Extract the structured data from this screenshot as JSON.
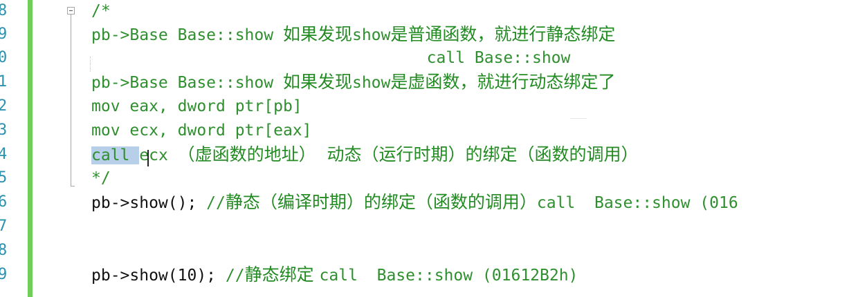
{
  "line_numbers": [
    "8",
    "9",
    "0",
    "1",
    "2",
    "3",
    "4",
    "5",
    "6",
    "7",
    "8",
    "9"
  ],
  "code_lines": [
    {
      "segments": [
        {
          "cls": "cm",
          "text": "/*"
        }
      ]
    },
    {
      "segments": [
        {
          "cls": "cm",
          "text": "pb->Base Base::show "
        },
        {
          "cls": "cn",
          "text": "如果发现"
        },
        {
          "cls": "cm",
          "text": "show"
        },
        {
          "cls": "cn",
          "text": "是普通函数，就进行静态绑定"
        }
      ]
    },
    {
      "segments": [
        {
          "cls": "cm",
          "text": "                                   call Base::show"
        }
      ]
    },
    {
      "segments": [
        {
          "cls": "cm",
          "text": "pb->Base Base::show "
        },
        {
          "cls": "cn",
          "text": "如果发现"
        },
        {
          "cls": "cm",
          "text": "show"
        },
        {
          "cls": "cn",
          "text": "是虚函数，就进行动态绑定了"
        }
      ]
    },
    {
      "segments": [
        {
          "cls": "cm",
          "text": "mov eax, dword ptr[pb]"
        }
      ]
    },
    {
      "segments": [
        {
          "cls": "cm",
          "text": "mov ecx, dword ptr[eax]"
        }
      ]
    },
    {
      "segments": [
        {
          "cls": "sel",
          "text": "call "
        },
        {
          "cls": "cm",
          "text": "ecx "
        },
        {
          "cls": "cn",
          "text": "（虚函数的地址）  动态（运行时期）的绑定（函数的调用）"
        }
      ]
    },
    {
      "segments": [
        {
          "cls": "cm",
          "text": "*/"
        }
      ]
    },
    {
      "segments": [
        {
          "cls": "code",
          "text": "pb->show(); "
        },
        {
          "cls": "cm",
          "text": "//"
        },
        {
          "cls": "cn",
          "text": "静态（编译时期）的绑定（函数的调用）"
        },
        {
          "cls": "cm",
          "text": "call  Base::show (016"
        }
      ]
    },
    {
      "segments": []
    },
    {
      "segments": []
    },
    {
      "segments": [
        {
          "cls": "code",
          "text": "pb->show(10); "
        },
        {
          "cls": "cm",
          "text": "//"
        },
        {
          "cls": "cn",
          "text": "静态绑定 "
        },
        {
          "cls": "cm",
          "text": "call  Base::show (01612B2h)"
        }
      ]
    }
  ]
}
